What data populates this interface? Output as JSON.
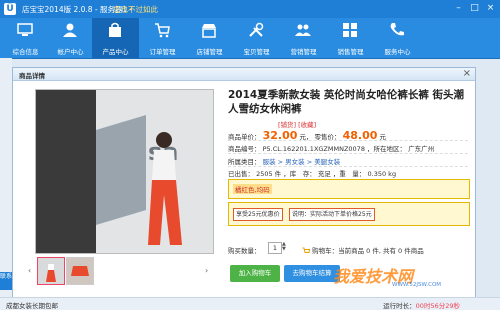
{
  "titlebar": {
    "title": "店宝宝2014版 2.0.8 - 服务器1 -",
    "vip_text": "您也不过如此",
    "controls": [
      "–",
      "□",
      "×"
    ]
  },
  "toolbar": {
    "items": [
      {
        "label": "综合信息",
        "icon": "monitor-icon"
      },
      {
        "label": "帐户中心",
        "icon": "user-icon"
      },
      {
        "label": "产品中心",
        "icon": "shopping-bag-icon",
        "active": true
      },
      {
        "label": "订单管理",
        "icon": "cart-icon"
      },
      {
        "label": "店铺管理",
        "icon": "store-icon"
      },
      {
        "label": "宝贝管理",
        "icon": "tools-icon"
      },
      {
        "label": "营销管理",
        "icon": "people-icon"
      },
      {
        "label": "销售管理",
        "icon": "grid-icon"
      },
      {
        "label": "服务中心",
        "icon": "phone-icon"
      }
    ]
  },
  "modal": {
    "title": "商品详情",
    "close": "×",
    "product_title": "2014夏季新款女装 英伦时尚女哈伦裤长裤 街头潮人雪纺女休闲裤",
    "tags": "[铺货] [收藏]",
    "price_label": "商品单价：",
    "price": "32.00",
    "price_unit": "元，",
    "retail_label": "零售价：",
    "retail": "48.00",
    "retail_unit": "元",
    "code_label": "商品编号：",
    "code": "P5.CL.162201.1XGZMMNZ0078",
    "location_label": "，所在地区：",
    "location": "广东广州",
    "category_label": "所属类目：",
    "category": "服装 > 男女装 > 美腿女装",
    "sold_label": "已出售：",
    "sold": "2505 件",
    "stock_label": "，库　存：",
    "stock": "充足",
    "weight_label": "，重　量：",
    "weight": "0.350 kg",
    "color_option": "橘红色,均码",
    "promo1": "享受25元优惠价",
    "promo2": "说明：实际活动下单价格25元",
    "qty_label": "购买数量：",
    "qty": "1",
    "cart_text": "购物车：当前商品 0 件, 共有 0 件商品",
    "add_to_cart": "加入购物车",
    "go_cart": "去购物车结算",
    "thumb_prev": "‹",
    "thumb_next": "›",
    "qty_up": "▲",
    "qty_down": "▼"
  },
  "statusbar": {
    "left": "成都女装长期包邮",
    "right_label": "运行时长：",
    "right_value": "00时56分29秒"
  },
  "watermark": {
    "main": "我爱技术网",
    "sub": "WWW.52JSW.COM"
  },
  "side_hint": "联系",
  "colors": {
    "accent": "#1f7fd6",
    "price": "#f26000",
    "cart_button": "#4db346"
  }
}
